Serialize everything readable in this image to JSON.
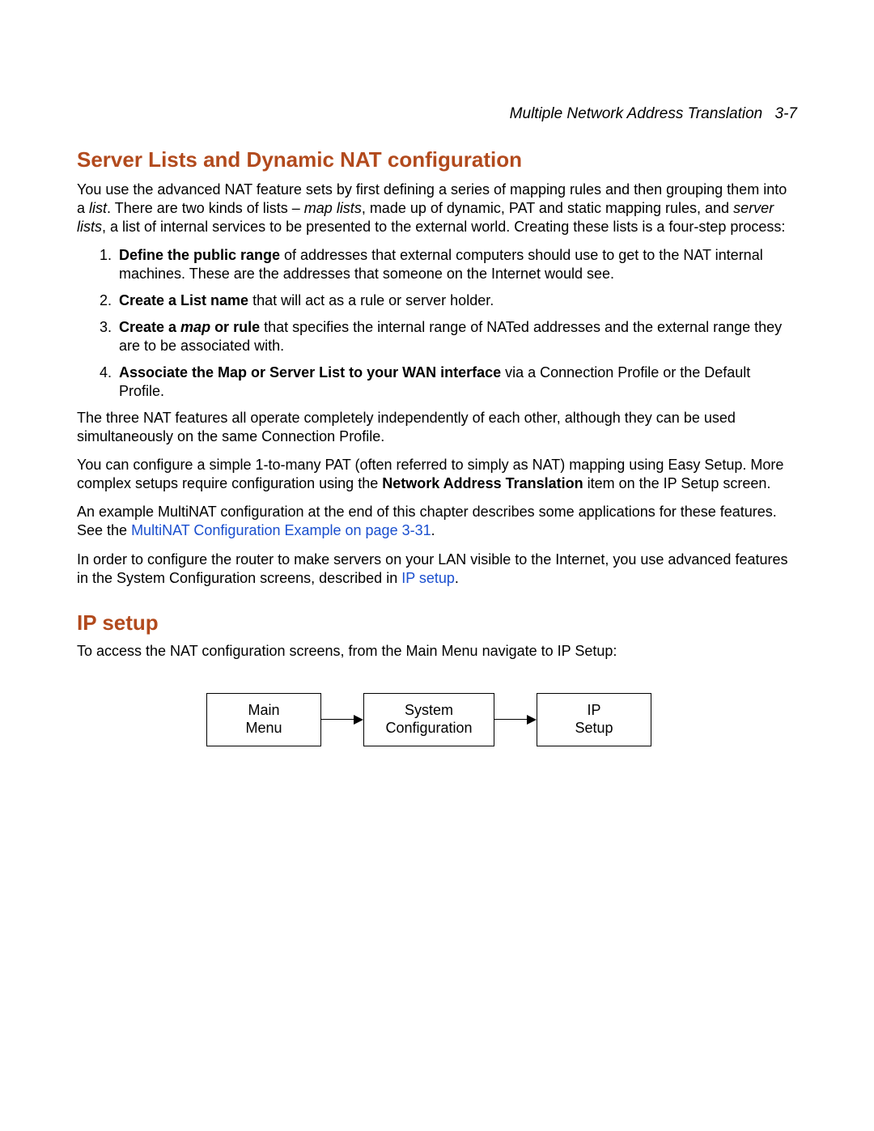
{
  "header": {
    "title": "Multiple Network Address Translation",
    "pageno": "3-7"
  },
  "h1": "Server Lists and Dynamic NAT configuration",
  "p1": {
    "t1": "You use the advanced NAT feature sets by first defining a series of mapping rules and then grouping them into a ",
    "list": "list",
    "t2": ". There are two kinds of lists – ",
    "maplists": "map lists",
    "t3": ", made up of dynamic, PAT and static mapping rules, and ",
    "serverlists": "server lists",
    "t4": ", a list of internal services to be presented to the external world. Creating these lists is a four-step process:"
  },
  "steps": [
    {
      "bold": "Define the public range",
      "rest": " of addresses that external computers should use to get to the NAT internal machines. These are the addresses that someone on the Internet would see."
    },
    {
      "bold": "Create a List name",
      "rest": " that will act as a rule or server holder."
    },
    {
      "bold1": "Create a ",
      "bolditalic": "map",
      "bold2": " or rule",
      "rest": " that specifies the internal range of NATed addresses and the external range they are to be associated with."
    },
    {
      "bold": "Associate the Map or Server List to your WAN interface",
      "rest": " via a Connection Profile or the Default Profile."
    }
  ],
  "p2": "The three NAT features all operate completely independently of each other, although they can be used simultaneously on the same Connection Profile.",
  "p3": {
    "t1": "You can configure a simple 1-to-many PAT (often referred to simply as NAT) mapping using Easy Setup. More complex setups require configuration using the ",
    "bold": "Network Address Translation",
    "t2": " item on the IP Setup screen."
  },
  "p4": {
    "t1": "An example MultiNAT configuration at the end of this chapter describes some applications for these features. See the ",
    "link": "MultiNAT Configuration Example on page 3-31",
    "t2": "."
  },
  "p5": {
    "t1": "In order to configure the router to make servers on your LAN visible to the Internet, you use advanced features in the System Configuration screens, described in ",
    "link": "IP setup",
    "t2": "."
  },
  "h2": "IP setup",
  "p6": "To access the NAT configuration screens, from the Main Menu navigate to IP Setup:",
  "diagram": {
    "box1": {
      "line1": "Main",
      "line2": "Menu"
    },
    "box2": {
      "line1": "System",
      "line2": "Configuration"
    },
    "box3": {
      "line1": "IP",
      "line2": "Setup"
    }
  }
}
